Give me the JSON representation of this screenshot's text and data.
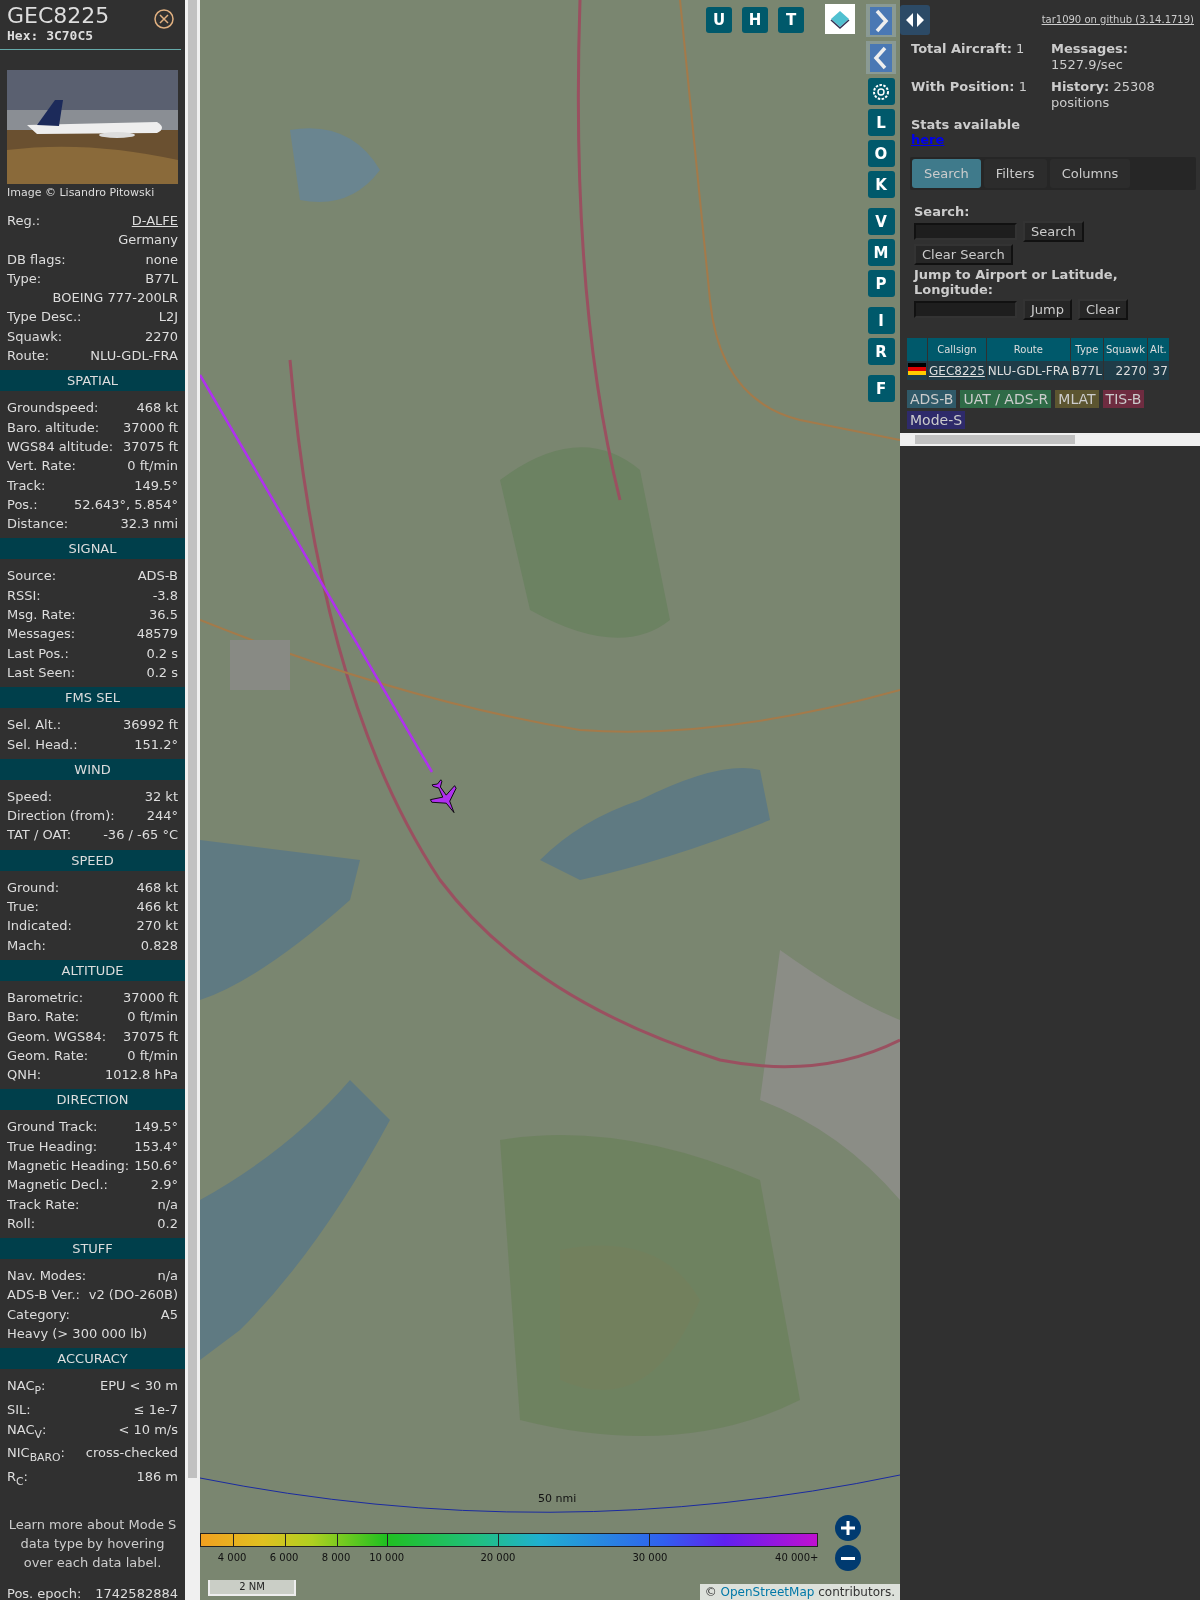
{
  "detail": {
    "callsign": "GEC8225",
    "hex": "Hex: 3C70C5",
    "photo_credit": "Image © Lisandro Pitowski",
    "rows": [
      {
        "kind": "link",
        "label": "Reg.:",
        "value": "D-ALFE"
      },
      {
        "kind": "value",
        "value": "Germany"
      },
      {
        "kind": "pair",
        "label": "DB flags:",
        "value": "none"
      },
      {
        "kind": "pair",
        "label": "Type:",
        "value": "B77L"
      },
      {
        "kind": "value",
        "value": "BOEING 777-200LR"
      },
      {
        "kind": "pair",
        "label": "Type Desc.:",
        "value": "L2J"
      },
      {
        "kind": "pair",
        "label": "Squawk:",
        "value": "2270"
      },
      {
        "kind": "pair",
        "label": "Route:",
        "value": "NLU-GDL-FRA"
      }
    ],
    "sections": [
      {
        "title": "SPATIAL",
        "rows": [
          {
            "kind": "pair",
            "label": "Groundspeed:",
            "value": "468 kt"
          },
          {
            "kind": "pair",
            "label": "Baro. altitude:",
            "value": "37000 ft"
          },
          {
            "kind": "pair",
            "label": "WGS84 altitude:",
            "value": "37075 ft"
          },
          {
            "kind": "pair",
            "label": "Vert. Rate:",
            "value": "0 ft/min"
          },
          {
            "kind": "pair",
            "label": "Track:",
            "value": "149.5°"
          },
          {
            "kind": "pair",
            "label": "Pos.:",
            "value": "52.643°, 5.854°"
          },
          {
            "kind": "pair",
            "label": "Distance:",
            "value": "32.3 nmi"
          }
        ]
      },
      {
        "title": "SIGNAL",
        "rows": [
          {
            "kind": "pair",
            "label": "Source:",
            "value": "ADS-B"
          },
          {
            "kind": "pair",
            "label": "RSSI:",
            "value": "-3.8"
          },
          {
            "kind": "pair",
            "label": "Msg. Rate:",
            "value": "36.5"
          },
          {
            "kind": "pair",
            "label": "Messages:",
            "value": "48579"
          },
          {
            "kind": "pair",
            "label": "Last Pos.:",
            "value": "0.2 s"
          },
          {
            "kind": "pair",
            "label": "Last Seen:",
            "value": "0.2 s"
          }
        ]
      },
      {
        "title": "FMS SEL",
        "rows": [
          {
            "kind": "pair",
            "label": "Sel. Alt.:",
            "value": "36992 ft"
          },
          {
            "kind": "pair",
            "label": "Sel. Head.:",
            "value": "151.2°"
          }
        ]
      },
      {
        "title": "WIND",
        "rows": [
          {
            "kind": "pair",
            "label": "Speed:",
            "value": "32 kt"
          },
          {
            "kind": "pair",
            "label": "Direction (from):",
            "value": "244°"
          },
          {
            "kind": "pair",
            "label": "TAT / OAT:",
            "value": "-36 / -65 °C"
          }
        ]
      },
      {
        "title": "SPEED",
        "rows": [
          {
            "kind": "pair",
            "label": "Ground:",
            "value": "468 kt"
          },
          {
            "kind": "pair",
            "label": "True:",
            "value": "466 kt"
          },
          {
            "kind": "pair",
            "label": "Indicated:",
            "value": "270 kt"
          },
          {
            "kind": "pair",
            "label": "Mach:",
            "value": "0.828"
          }
        ]
      },
      {
        "title": "ALTITUDE",
        "rows": [
          {
            "kind": "pair",
            "label": "Barometric:",
            "value": "37000 ft"
          },
          {
            "kind": "pair",
            "label": "Baro. Rate:",
            "value": "0 ft/min"
          },
          {
            "kind": "pair",
            "label": "Geom. WGS84:",
            "value": "37075 ft"
          },
          {
            "kind": "pair",
            "label": "Geom. Rate:",
            "value": "0 ft/min"
          },
          {
            "kind": "pair",
            "label": "QNH:",
            "value": "1012.8 hPa"
          }
        ]
      },
      {
        "title": "DIRECTION",
        "rows": [
          {
            "kind": "pair",
            "label": "Ground Track:",
            "value": "149.5°"
          },
          {
            "kind": "pair",
            "label": "True Heading:",
            "value": "153.4°"
          },
          {
            "kind": "pair",
            "label": "Magnetic Heading:",
            "value": "150.6°"
          },
          {
            "kind": "pair",
            "label": "Magnetic Decl.:",
            "value": "2.9°"
          },
          {
            "kind": "pair",
            "label": "Track Rate:",
            "value": "n/a"
          },
          {
            "kind": "pair",
            "label": "Roll:",
            "value": "0.2"
          }
        ]
      },
      {
        "title": "STUFF",
        "rows": [
          {
            "kind": "pair",
            "label": "Nav. Modes:",
            "value": "n/a"
          },
          {
            "kind": "pair",
            "label": "ADS-B Ver.:",
            "value": "v2 (DO-260B)"
          },
          {
            "kind": "pair",
            "label": "Category:",
            "value": "A5"
          },
          {
            "kind": "label",
            "label": "Heavy (> 300 000 lb)"
          }
        ]
      },
      {
        "title": "ACCURACY",
        "rows": [
          {
            "kind": "pair",
            "label": "NAC$_{P}$:",
            "value": "EPU < 30 m"
          },
          {
            "kind": "pair",
            "label": "SIL:",
            "value": "≤ 1e-7"
          },
          {
            "kind": "pair",
            "label": "NAC$_{V}$:",
            "value": "< 10 m/s"
          },
          {
            "kind": "pair",
            "label": "NIC$_{BARO}$:",
            "value": "cross-checked"
          },
          {
            "kind": "pair",
            "label": "R$_{C}$:",
            "value": "186 m"
          }
        ]
      }
    ],
    "note": "Learn more about Mode S data type by hovering over each data label.",
    "epoch": {
      "label": "Pos. epoch:",
      "value": "1742582884"
    }
  },
  "map": {
    "top_buttons": [
      "U",
      "H",
      "T"
    ],
    "side_buttons": [
      {
        "kind": "next"
      },
      {
        "kind": "prev"
      },
      {
        "kind": "settings"
      },
      {
        "kind": "letter",
        "label": "L"
      },
      {
        "kind": "letter",
        "label": "O"
      },
      {
        "kind": "letter",
        "label": "K"
      },
      {
        "kind": "letter",
        "label": "V"
      },
      {
        "kind": "letter",
        "label": "M"
      },
      {
        "kind": "letter",
        "label": "P"
      },
      {
        "kind": "letter",
        "label": "I"
      },
      {
        "kind": "letter",
        "label": "R"
      },
      {
        "kind": "letter",
        "label": "F"
      }
    ],
    "range_label": "50 nmi",
    "altitude_scale": [
      "4 000",
      "6 000",
      "8 000",
      "10 000",
      "20 000",
      "30 000",
      "40 000+"
    ],
    "scale_label": "2 NM",
    "attribution": {
      "prefix": "©",
      "link": "OpenStreetMap",
      "suffix": "contributors."
    }
  },
  "sidebar": {
    "version_link": "tar1090 on github (3.14.1719)",
    "stats": [
      "**Total Aircraft:** 1",
      "**Messages:** 1527.9/sec",
      "**With Position:** 1",
      "**History:** 25308 positions"
    ],
    "stats_label": "Stats available",
    "stats_link": "here",
    "tabs": [
      {
        "label": "Search",
        "selected": true
      },
      {
        "label": "Filters",
        "selected": false
      },
      {
        "label": "Columns",
        "selected": false
      }
    ],
    "search_label": "Search:",
    "search_button": "Search",
    "clear_search_button": "Clear Search",
    "jump_label": "Jump to Airport or Latitude, Longitude:",
    "jump_button": "Jump",
    "clear_button": "Clear",
    "table": {
      "columns": [
        "Callsign",
        "Route",
        "Type",
        "Squawk",
        "Alt."
      ],
      "rows": [
        {
          "cells": [
            "GEC8225",
            "NLU-GDL-FRA",
            "B77L",
            "2270",
            "37"
          ]
        }
      ]
    },
    "legend": [
      {
        "label": "ADS-B",
        "color": "#2f5968"
      },
      {
        "label": "UAT / ADS-R",
        "color": "#2f6b47"
      },
      {
        "label": "MLAT",
        "color": "#5c5530"
      },
      {
        "label": "TIS-B",
        "color": "#6e2c40"
      },
      {
        "label": "Mode-S",
        "color": "#2e2a6a"
      }
    ]
  }
}
